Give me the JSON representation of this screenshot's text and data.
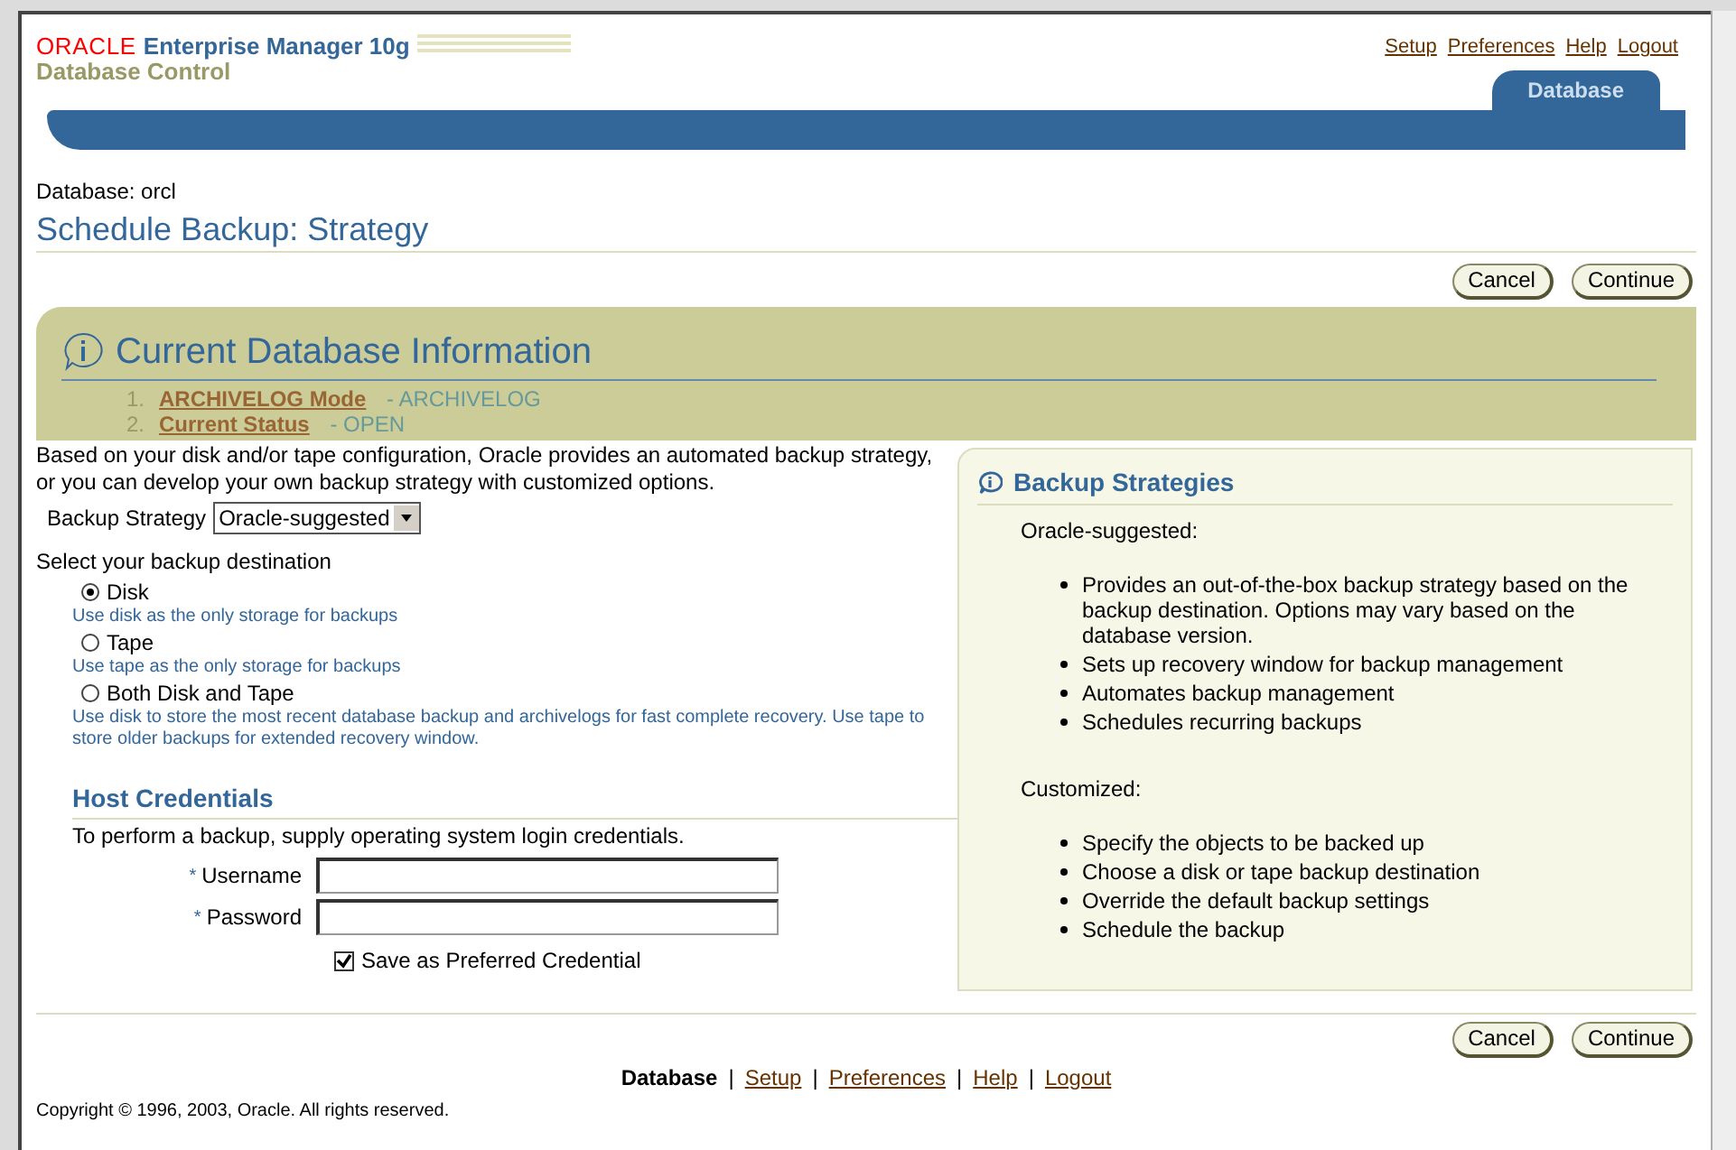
{
  "brand": {
    "logo": "ORACLE",
    "product": "Enterprise Manager 10g",
    "subtitle": "Database Control"
  },
  "global_links": [
    {
      "label": "Setup"
    },
    {
      "label": "Preferences"
    },
    {
      "label": "Help"
    },
    {
      "label": "Logout"
    }
  ],
  "tabs": [
    {
      "label": "Database",
      "selected": true
    }
  ],
  "database_label": "Database: orcl",
  "page_title": "Schedule Backup: Strategy",
  "buttons": [
    "Cancel",
    "Continue"
  ],
  "bottom_buttons": [
    "Cancel",
    "Continue"
  ],
  "info": {
    "title": "Current Database Information",
    "items": [
      {
        "number": "1.",
        "link": "ARCHIVELOG Mode",
        "value": " - ARCHIVELOG"
      },
      {
        "number": "2.",
        "link": "Current Status",
        "value": " - OPEN"
      }
    ]
  },
  "intro": "Based on your disk and/or tape configuration, Oracle provides an automated backup strategy, or you can develop your own backup strategy with customized options.",
  "backup_strategy": {
    "label": "Backup Strategy",
    "value": "Oracle-suggested"
  },
  "destination": {
    "label": "Select your backup destination",
    "options": [
      {
        "label": "Disk",
        "hint": "Use disk as the only storage for backups",
        "selected": true
      },
      {
        "label": "Tape",
        "hint": "Use tape as the only storage for backups",
        "selected": false
      },
      {
        "label": "Both Disk and Tape",
        "hint": "Use disk to store the most recent database backup and archivelogs for fast complete recovery. Use tape to store older backups for extended recovery window.",
        "selected": false
      }
    ]
  },
  "credentials": {
    "title": "Host Credentials",
    "description": "To perform a backup, supply operating system login credentials.",
    "fields": [
      {
        "label": "Username",
        "required": true,
        "marker": "*"
      },
      {
        "label": "Password",
        "required": true,
        "marker": "*"
      }
    ],
    "save": {
      "label": "Save as Preferred Credential",
      "checked": true
    }
  },
  "tip": {
    "title": "Backup Strategies",
    "sections": [
      {
        "heading": "Oracle-suggested:",
        "items": [
          "Provides an out-of-the-box backup strategy based on the backup destination. Options may vary based on the database version.",
          "Sets up recovery window for backup management",
          "Automates backup management",
          "Schedules recurring backups"
        ]
      },
      {
        "heading": "Customized:",
        "items": [
          "Specify the objects to be backed up",
          "Choose a disk or tape backup destination",
          "Override the default backup settings",
          "Schedule the backup"
        ]
      }
    ]
  },
  "footer_links": [
    {
      "label": "Database",
      "selected": true
    },
    {
      "label": "Setup",
      "selected": false,
      "separator": "|"
    },
    {
      "label": "Preferences",
      "selected": false,
      "separator": "|"
    },
    {
      "label": "Help",
      "selected": false,
      "separator": "|"
    },
    {
      "label": "Logout",
      "selected": false,
      "separator": "|"
    }
  ],
  "copyright": "Copyright © 1996, 2003, Oracle. All rights reserved."
}
